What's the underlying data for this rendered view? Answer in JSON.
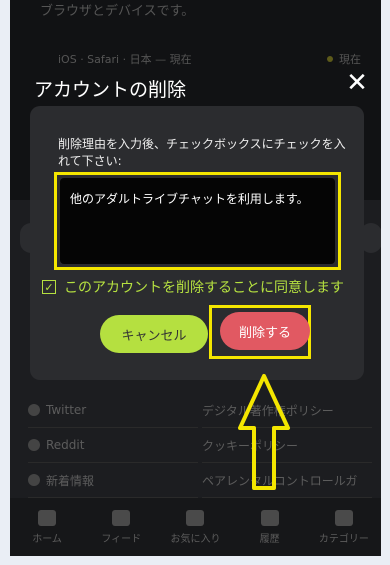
{
  "background": {
    "session_desc": "ブラウザとデバイスです。",
    "session_meta": "iOS · Safari · 日本 — 現在",
    "session_status": "現在",
    "links_left": [
      "Twitter",
      "Reddit",
      "新着情報"
    ],
    "links_right": [
      "デジタル著作権ポリシー",
      "クッキーポリシー",
      "ペアレンタルコントロールガ"
    ]
  },
  "modal": {
    "title": "アカウントの削除",
    "close_symbol": "✕",
    "instruction": "削除理由を入力後、チェックボックスにチェックを入れて下さい:",
    "reason_value": "他のアダルトライブチャットを利用します。",
    "agree_label": "このアカウントを削除することに同意します",
    "agree_checked": true,
    "cancel_label": "キャンセル",
    "delete_label": "削除する"
  },
  "tabbar": {
    "items": [
      {
        "label": "ホーム",
        "icon": "home-icon"
      },
      {
        "label": "フィード",
        "icon": "feed-icon"
      },
      {
        "label": "お気に入り",
        "icon": "heart-icon"
      },
      {
        "label": "履歴",
        "icon": "clock-icon"
      },
      {
        "label": "カテゴリー",
        "icon": "grid-icon"
      }
    ]
  },
  "colors": {
    "accent_green": "#b5e040",
    "delete_red": "#e15962",
    "highlight_yellow": "#f4e600"
  }
}
